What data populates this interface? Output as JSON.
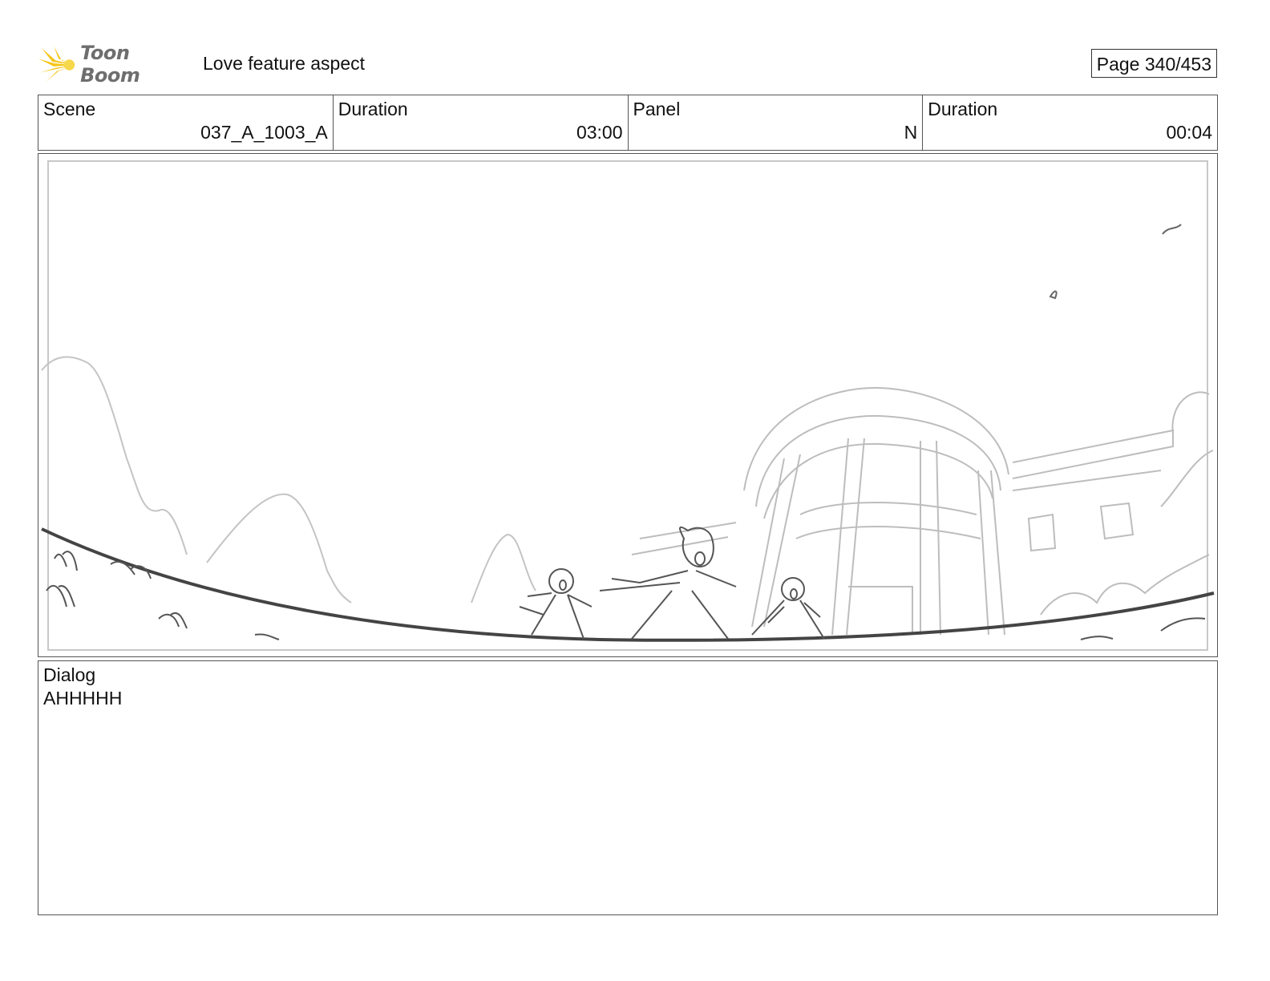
{
  "header": {
    "logo_text": "Toon Boom",
    "title": "Love feature aspect",
    "page": "Page 340/453"
  },
  "info": {
    "scene_label": "Scene",
    "scene_value": "037_A_1003_A",
    "scene_duration_label": "Duration",
    "scene_duration_value": "03:00",
    "panel_label": "Panel",
    "panel_value": "N",
    "panel_duration_label": "Duration",
    "panel_duration_value": "00:04"
  },
  "dialog": {
    "label": "Dialog",
    "text": "AHHHHH"
  },
  "colors": {
    "logo_yellow": "#f5c518",
    "logo_text": "#6e6e6e",
    "sketch_light": "#bdbdbd",
    "sketch_dark": "#444444"
  }
}
